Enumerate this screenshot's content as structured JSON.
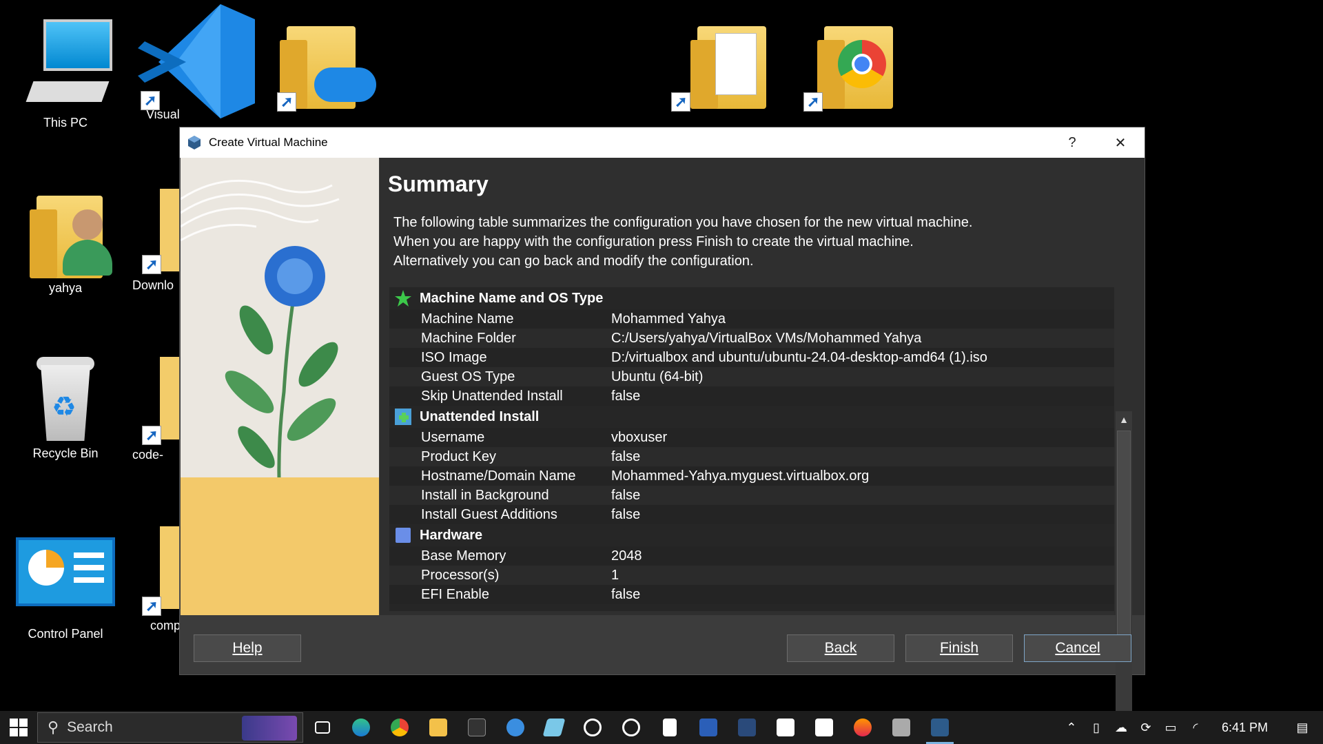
{
  "desktop": {
    "icons": [
      {
        "label": "This PC"
      },
      {
        "label": "Visual"
      },
      {
        "label": ""
      },
      {
        "label": ""
      },
      {
        "label": ""
      },
      {
        "label": "yahya"
      },
      {
        "label": "Downlo"
      },
      {
        "label": "Recycle Bin"
      },
      {
        "label": "code-"
      },
      {
        "label": "Control Panel"
      },
      {
        "label": "comp"
      }
    ]
  },
  "dialog": {
    "title": "Create Virtual Machine",
    "help_glyph": "?",
    "close_glyph": "✕",
    "heading": "Summary",
    "intro_lines": [
      "The following table summarizes the configuration you have chosen for the new virtual machine.",
      "When you are happy with the configuration press Finish to create the virtual machine.",
      "Alternatively you can go back and modify the configuration."
    ],
    "sections": [
      {
        "title": "Machine Name and OS Type",
        "icon": "green-star-icon",
        "rows": [
          {
            "key": "Machine Name",
            "value": "Mohammed Yahya"
          },
          {
            "key": "Machine Folder",
            "value": "C:/Users/yahya/VirtualBox VMs/Mohammed Yahya"
          },
          {
            "key": "ISO Image",
            "value": "D:/virtualbox and ubuntu/ubuntu-24.04-desktop-amd64 (1).iso"
          },
          {
            "key": "Guest OS Type",
            "value": "Ubuntu (64-bit)"
          },
          {
            "key": "Skip Unattended Install",
            "value": "false"
          }
        ]
      },
      {
        "title": "Unattended Install",
        "icon": "install-plus-icon",
        "rows": [
          {
            "key": "Username",
            "value": "vboxuser"
          },
          {
            "key": "Product Key",
            "value": "false"
          },
          {
            "key": "Hostname/Domain Name",
            "value": "Mohammed-Yahya.myguest.virtualbox.org"
          },
          {
            "key": "Install in Background",
            "value": "false"
          },
          {
            "key": "Install Guest Additions",
            "value": "false"
          }
        ]
      },
      {
        "title": "Hardware",
        "icon": "hardware-chip-icon",
        "rows": [
          {
            "key": "Base Memory",
            "value": "2048"
          },
          {
            "key": "Processor(s)",
            "value": "1"
          },
          {
            "key": "EFI Enable",
            "value": "false"
          }
        ]
      }
    ],
    "buttons": {
      "help": "Help",
      "back": "Back",
      "finish": "Finish",
      "cancel": "Cancel"
    }
  },
  "taskbar": {
    "search_placeholder": "Search",
    "clock": "6:41 PM"
  },
  "colors": {
    "dialog_bg": "#3c3c3c",
    "table_bg": "#262626",
    "accent": "#7fa7c9"
  }
}
